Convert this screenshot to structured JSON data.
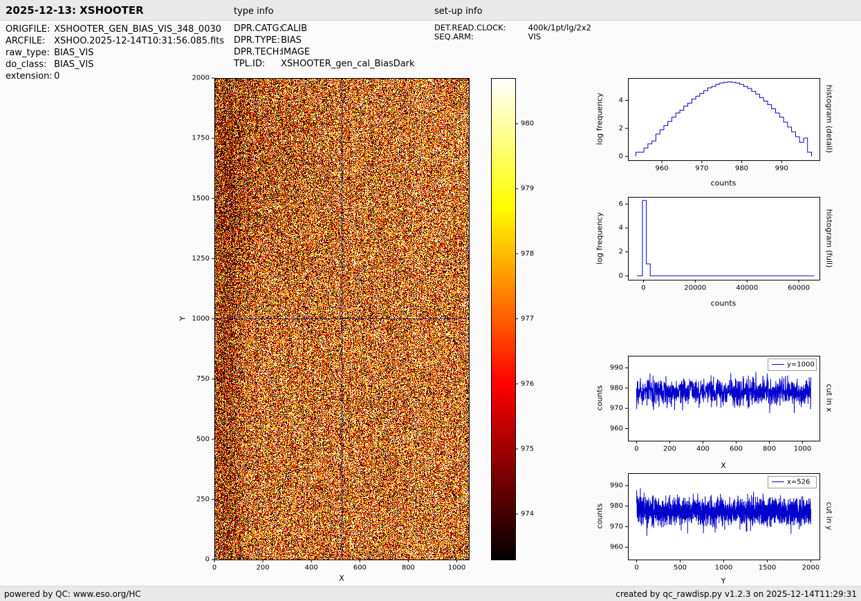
{
  "header": {
    "title": "2025-12-13: XSHOOTER",
    "type_info_label": "type info",
    "setup_info_label": "set-up info"
  },
  "metadata": {
    "left": [
      {
        "label": "ORIGFILE:",
        "value": "XSHOOTER_GEN_BIAS_VIS_348_0030"
      },
      {
        "label": "ARCFILE:",
        "value": "XSHOO.2025-12-14T10:31:56.085.fits"
      },
      {
        "label": "raw_type:",
        "value": "BIAS_VIS"
      },
      {
        "label": "do_class:",
        "value": "BIAS_VIS"
      },
      {
        "label": "extension:",
        "value": "0"
      }
    ],
    "type_info": [
      {
        "label": "DPR.CATG:",
        "value": "CALIB"
      },
      {
        "label": "DPR.TYPE:",
        "value": "BIAS"
      },
      {
        "label": "DPR.TECH:",
        "value": "IMAGE"
      },
      {
        "label": "TPL.ID:",
        "value": "XSHOOTER_gen_cal_BiasDark"
      }
    ],
    "setup_info": [
      {
        "label": "DET.READ.CLOCK:",
        "value": "400k/1pt/lg/2x2"
      },
      {
        "label": "SEQ.ARM:",
        "value": "VIS"
      }
    ]
  },
  "footer": {
    "left": "powered by QC: www.eso.org/HC",
    "right": "created by qc_rawdisp.py v1.2.3 on 2025-12-14T11:29:31"
  },
  "chart_data": [
    {
      "id": "bias_image",
      "type": "heatmap",
      "title": "",
      "xlabel": "X",
      "ylabel": "Y",
      "xlim": [
        0,
        1050
      ],
      "ylim": [
        0,
        2000
      ],
      "xticks": [
        0,
        200,
        400,
        600,
        800,
        1000
      ],
      "yticks": [
        0,
        250,
        500,
        750,
        1000,
        1250,
        1500,
        1750,
        2000
      ],
      "colormap": "hot",
      "vmin": 973.3,
      "vmax": 980.7,
      "noise": {
        "mean": 977.1,
        "std": 3.2,
        "seed": 42
      },
      "crosshair": {
        "x": 526,
        "y": 1000,
        "color": "#00008b"
      },
      "colorbar": {
        "position": "right",
        "ticks": [
          974,
          975,
          976,
          977,
          978,
          979,
          980
        ]
      }
    },
    {
      "id": "hist_detail",
      "type": "histogram-step",
      "right_label": "histogram (detail)",
      "xlabel": "counts",
      "ylabel": "log frequency",
      "color": "#0000cc",
      "xlim": [
        951.5,
        999.5
      ],
      "ylim": [
        -0.28,
        5.6
      ],
      "xticks": [
        960,
        970,
        980,
        990
      ],
      "yticks": [
        0,
        2,
        4
      ],
      "x": [
        954,
        955,
        956,
        957,
        958,
        959,
        960,
        961,
        962,
        963,
        964,
        965,
        966,
        967,
        968,
        969,
        970,
        971,
        972,
        973,
        974,
        975,
        976,
        977,
        978,
        979,
        980,
        981,
        982,
        983,
        984,
        985,
        986,
        987,
        988,
        989,
        990,
        991,
        992,
        993,
        994,
        995,
        996,
        997
      ],
      "y": [
        0.3,
        0.3,
        0.6,
        0.9,
        1.1,
        1.6,
        1.9,
        2.2,
        2.5,
        2.8,
        3.1,
        3.3,
        3.6,
        3.8,
        4.1,
        4.3,
        4.5,
        4.7,
        4.9,
        5.0,
        5.15,
        5.25,
        5.3,
        5.32,
        5.3,
        5.25,
        5.15,
        5.0,
        4.85,
        4.65,
        4.45,
        4.2,
        3.95,
        3.7,
        3.4,
        3.1,
        2.8,
        2.45,
        2.1,
        1.75,
        1.4,
        1.0,
        1.3,
        0.3
      ]
    },
    {
      "id": "hist_full",
      "type": "line",
      "right_label": "histogram (full)",
      "xlabel": "counts",
      "ylabel": "log frequency",
      "color": "#0000cc",
      "xlim": [
        -6000,
        68000
      ],
      "ylim": [
        -0.33,
        6.6
      ],
      "xticks": [
        0,
        20000,
        40000,
        60000
      ],
      "yticks": [
        0,
        2,
        4,
        6
      ],
      "x": [
        -2500,
        -400,
        -400,
        1100,
        1100,
        2600,
        2600,
        66000
      ],
      "y": [
        0,
        0,
        6.3,
        6.3,
        1.0,
        1.0,
        0,
        0
      ]
    },
    {
      "id": "cut_x",
      "type": "line",
      "legend": "y=1000",
      "right_label": "cut in x",
      "xlabel": "X",
      "ylabel": "counts",
      "color": "#0000cc",
      "xlim": [
        -52,
        1102
      ],
      "ylim": [
        954,
        996
      ],
      "xticks": [
        0,
        200,
        400,
        600,
        800,
        1000
      ],
      "yticks": [
        960,
        970,
        980,
        990
      ],
      "noise": {
        "n": 1050,
        "x_start": 0,
        "x_end": 1050,
        "mean": 978,
        "std": 3.3,
        "seed": 7
      }
    },
    {
      "id": "cut_y",
      "type": "line",
      "legend": "x=526",
      "right_label": "cut in y",
      "xlabel": "Y",
      "ylabel": "counts",
      "color": "#0000cc",
      "xlim": [
        -100,
        2100
      ],
      "ylim": [
        954,
        996
      ],
      "xticks": [
        0,
        500,
        1000,
        1500,
        2000
      ],
      "yticks": [
        960,
        970,
        980,
        990
      ],
      "noise": {
        "n": 2000,
        "x_start": 0,
        "x_end": 2000,
        "mean": 977.5,
        "std": 3.3,
        "seed": 11
      }
    }
  ]
}
